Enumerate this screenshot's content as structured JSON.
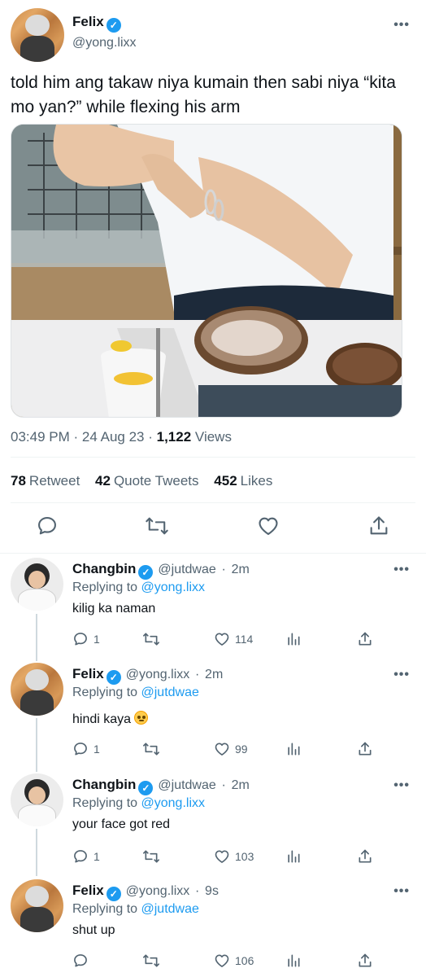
{
  "main": {
    "name": "Felix",
    "handle": "@yong.lixx",
    "text": "told him ang takaw niya kumain then sabi niya “kita mo yan?” while flexing his arm",
    "time": "03:49 PM",
    "date": "24 Aug 23",
    "views_count": "1,122",
    "views_label": "Views",
    "retweets": "78",
    "retweets_label": "Retweet",
    "quotes": "42",
    "quotes_label": "Quote Tweets",
    "likes": "452",
    "likes_label": "Likes"
  },
  "replying_label": "Replying to",
  "replies": [
    {
      "name": "Changbin",
      "handle": "@jutdwae",
      "time": "2m",
      "replying_to": "@yong.lixx",
      "text": "kilig ka naman",
      "reply_count": "1",
      "like_count": "114"
    },
    {
      "name": "Felix",
      "handle": "@yong.lixx",
      "time": "2m",
      "replying_to": "@jutdwae",
      "text": "hindi kaya",
      "reply_count": "1",
      "like_count": "99"
    },
    {
      "name": "Changbin",
      "handle": "@jutdwae",
      "time": "2m",
      "replying_to": "@yong.lixx",
      "text": "your face got red",
      "reply_count": "1",
      "like_count": "103"
    },
    {
      "name": "Felix",
      "handle": "@yong.lixx",
      "time": "9s",
      "replying_to": "@jutdwae",
      "text": "shut up",
      "reply_count": "",
      "like_count": "106"
    }
  ],
  "separator": "·",
  "more_glyph": "•••",
  "verified_glyph": "✓",
  "colors": {
    "accent": "#1d9bf0",
    "text": "#0f1419",
    "muted": "#536471",
    "divider": "#eff3f4"
  },
  "icons": [
    "verified-badge-icon",
    "more-icon",
    "reply-icon",
    "retweet-icon",
    "like-icon",
    "share-icon",
    "analytics-icon",
    "emoji-flushed-icon"
  ]
}
